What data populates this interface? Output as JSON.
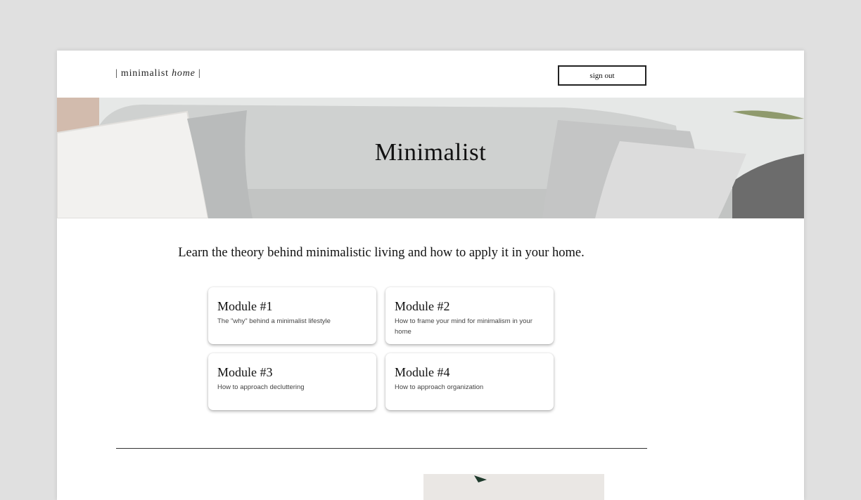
{
  "header": {
    "logo_prefix": "| minimalist ",
    "logo_italic": "home",
    "logo_suffix": " |",
    "signout_label": "sign out"
  },
  "hero": {
    "title": "Minimalist"
  },
  "main": {
    "intro": "Learn the theory behind minimalistic living and how to apply it in your home.",
    "modules": [
      {
        "title": "Module #1",
        "desc": "The \"why\" behind a minimalist lifestyle"
      },
      {
        "title": "Module #2",
        "desc": "How to frame your mind for minimalism in your home"
      },
      {
        "title": "Module #3",
        "desc": "How to approach decluttering"
      },
      {
        "title": "Module #4",
        "desc": "How to approach organization"
      }
    ]
  },
  "colors": {
    "page_background": "#e0e0e0",
    "surface": "#ffffff",
    "text": "#111111",
    "muted_text": "#444444"
  }
}
